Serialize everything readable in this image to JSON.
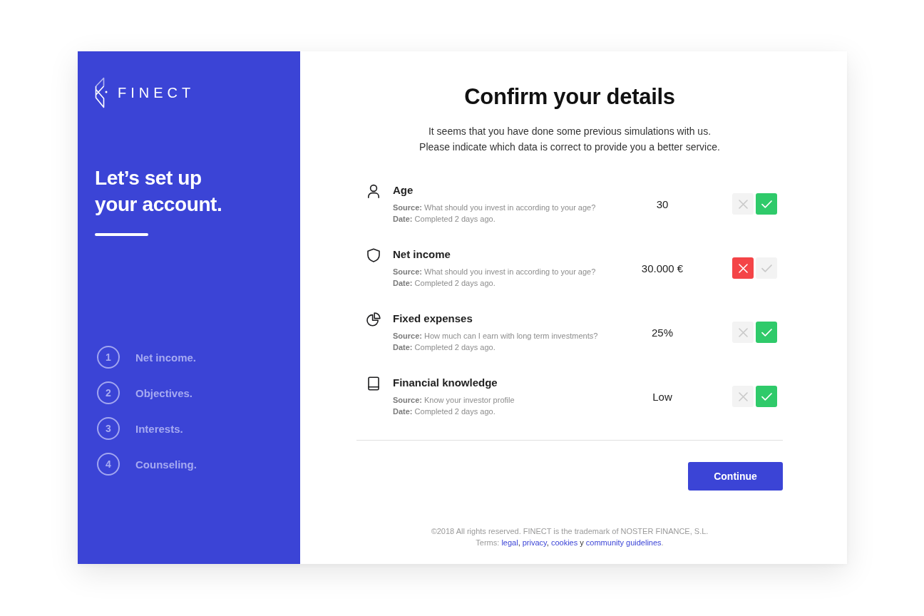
{
  "brand": {
    "name": "FINECT"
  },
  "sidebar": {
    "heading": "Let’s set up your account.",
    "steps": [
      {
        "number": "1",
        "label": "Net income."
      },
      {
        "number": "2",
        "label": "Objectives."
      },
      {
        "number": "3",
        "label": "Interests."
      },
      {
        "number": "4",
        "label": "Counseling."
      }
    ]
  },
  "main": {
    "title": "Confirm your details",
    "intro": [
      "It seems that you have done some previous simulations with us.",
      "Please indicate which data is correct to provide you a better service."
    ],
    "items": [
      {
        "kind": "age",
        "title": "Age",
        "source": "**Source:** What should you invest in according to your age?",
        "date": "**Date:** Completed 2 days ago.",
        "value": "30",
        "rejected": false,
        "accepted": true
      },
      {
        "kind": "income",
        "title": "Net income",
        "source": "**Source:** What should you invest in according to your age?",
        "date": "**Date:** Completed 2 days ago.",
        "value": "30.000 €",
        "rejected": true,
        "accepted": false
      },
      {
        "kind": "expenses",
        "title": "Fixed expenses",
        "source": "**Source:** How much can I earn with long term investments?",
        "date": "**Date:** Completed 2 days ago.",
        "value": "25%",
        "rejected": false,
        "accepted": true
      },
      {
        "kind": "knowledge",
        "title": "Financial knowledge",
        "source": "**Source:** Know your investor profile",
        "date": "**Date:** Completed 2 days ago.",
        "value": "Low",
        "rejected": false,
        "accepted": true
      }
    ],
    "continue_button": "Continue",
    "footer": {
      "copyright": "©2018 All rights reserved. FINECT is the trademark of NOSTER FINANCE, S.L.",
      "terms": [
        {
          "kind": "label",
          "text": "Terms: "
        },
        {
          "kind": "link",
          "text": "legal"
        },
        {
          "kind": "text",
          "text": ", "
        },
        {
          "kind": "link",
          "text": "privacy"
        },
        {
          "kind": "text",
          "text": ", "
        },
        {
          "kind": "link",
          "text": "cookies"
        },
        {
          "kind": "text",
          "text": " y "
        },
        {
          "kind": "link",
          "text": "community guidelines"
        },
        {
          "kind": "label",
          "text": "."
        }
      ]
    }
  }
}
